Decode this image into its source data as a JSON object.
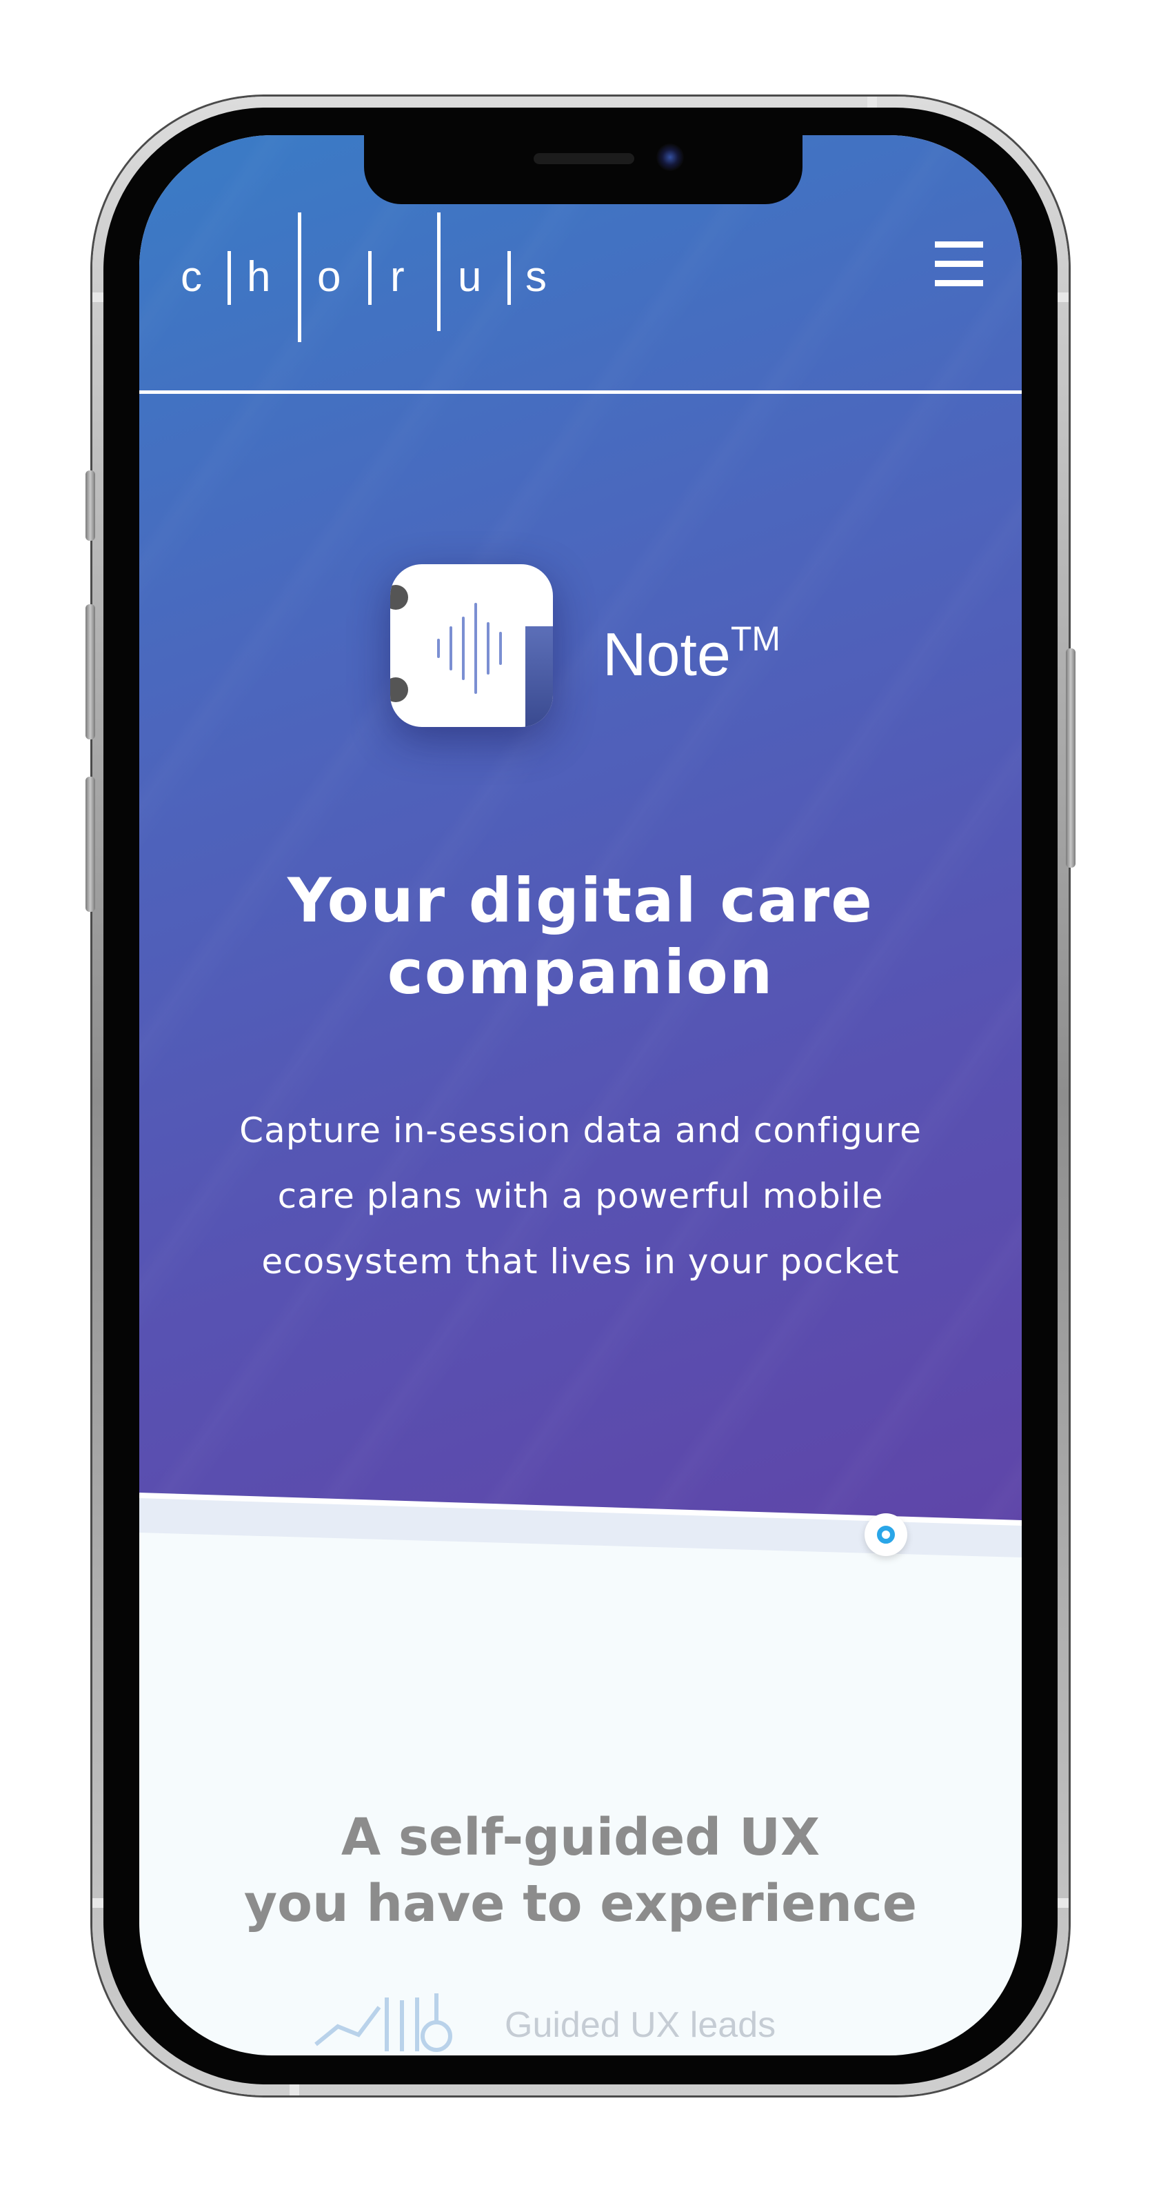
{
  "header": {
    "logo_letters": [
      "c",
      "h",
      "o",
      "r",
      "u",
      "s"
    ],
    "menu_icon": "hamburger-menu-icon"
  },
  "hero": {
    "app_name": "Note",
    "app_name_suffix": "TM",
    "title_line1": "Your digital care",
    "title_line2": "companion",
    "subtitle_line1": "Capture in-session data and configure",
    "subtitle_line2": "care plans with a powerful mobile",
    "subtitle_line3": "ecosystem that lives in your pocket"
  },
  "section": {
    "title_line1": "A self-guided UX",
    "title_line2": "you have to experience",
    "feature_text": "Guided UX leads",
    "feature_icon": "chart-bars-icon"
  },
  "colors": {
    "hero_start": "#3a7cc6",
    "hero_end": "#5f45a8",
    "accent_blue": "#2aa6e8",
    "section_title": "#8c8c8c",
    "section_bg": "#f6fbfd"
  }
}
